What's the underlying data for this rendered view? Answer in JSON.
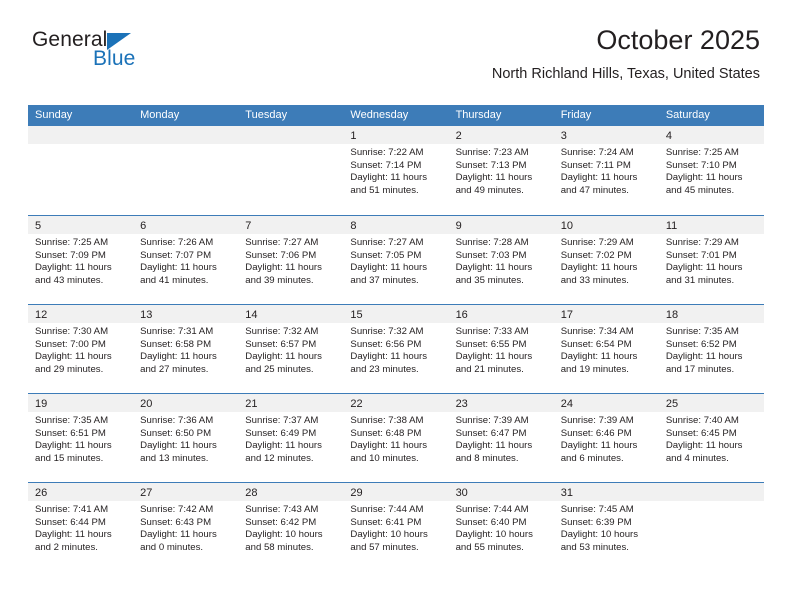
{
  "brand": {
    "name_part1": "General",
    "name_part2": "Blue",
    "triangle_icon": "blue-triangle-icon",
    "accent_color": "#1b72b8"
  },
  "header": {
    "title": "October 2025",
    "subtitle": "North Richland Hills, Texas, United States"
  },
  "theme": {
    "header_band": "#3d7cb8",
    "day_strip": "#f1f1f1",
    "text": "#231f20"
  },
  "weekdays": [
    "Sunday",
    "Monday",
    "Tuesday",
    "Wednesday",
    "Thursday",
    "Friday",
    "Saturday"
  ],
  "weeks": [
    [
      {
        "day": "",
        "sunrise": "",
        "sunset": "",
        "daylight1": "",
        "daylight2": ""
      },
      {
        "day": "",
        "sunrise": "",
        "sunset": "",
        "daylight1": "",
        "daylight2": ""
      },
      {
        "day": "",
        "sunrise": "",
        "sunset": "",
        "daylight1": "",
        "daylight2": ""
      },
      {
        "day": "1",
        "sunrise": "Sunrise: 7:22 AM",
        "sunset": "Sunset: 7:14 PM",
        "daylight1": "Daylight: 11 hours",
        "daylight2": "and 51 minutes."
      },
      {
        "day": "2",
        "sunrise": "Sunrise: 7:23 AM",
        "sunset": "Sunset: 7:13 PM",
        "daylight1": "Daylight: 11 hours",
        "daylight2": "and 49 minutes."
      },
      {
        "day": "3",
        "sunrise": "Sunrise: 7:24 AM",
        "sunset": "Sunset: 7:11 PM",
        "daylight1": "Daylight: 11 hours",
        "daylight2": "and 47 minutes."
      },
      {
        "day": "4",
        "sunrise": "Sunrise: 7:25 AM",
        "sunset": "Sunset: 7:10 PM",
        "daylight1": "Daylight: 11 hours",
        "daylight2": "and 45 minutes."
      }
    ],
    [
      {
        "day": "5",
        "sunrise": "Sunrise: 7:25 AM",
        "sunset": "Sunset: 7:09 PM",
        "daylight1": "Daylight: 11 hours",
        "daylight2": "and 43 minutes."
      },
      {
        "day": "6",
        "sunrise": "Sunrise: 7:26 AM",
        "sunset": "Sunset: 7:07 PM",
        "daylight1": "Daylight: 11 hours",
        "daylight2": "and 41 minutes."
      },
      {
        "day": "7",
        "sunrise": "Sunrise: 7:27 AM",
        "sunset": "Sunset: 7:06 PM",
        "daylight1": "Daylight: 11 hours",
        "daylight2": "and 39 minutes."
      },
      {
        "day": "8",
        "sunrise": "Sunrise: 7:27 AM",
        "sunset": "Sunset: 7:05 PM",
        "daylight1": "Daylight: 11 hours",
        "daylight2": "and 37 minutes."
      },
      {
        "day": "9",
        "sunrise": "Sunrise: 7:28 AM",
        "sunset": "Sunset: 7:03 PM",
        "daylight1": "Daylight: 11 hours",
        "daylight2": "and 35 minutes."
      },
      {
        "day": "10",
        "sunrise": "Sunrise: 7:29 AM",
        "sunset": "Sunset: 7:02 PM",
        "daylight1": "Daylight: 11 hours",
        "daylight2": "and 33 minutes."
      },
      {
        "day": "11",
        "sunrise": "Sunrise: 7:29 AM",
        "sunset": "Sunset: 7:01 PM",
        "daylight1": "Daylight: 11 hours",
        "daylight2": "and 31 minutes."
      }
    ],
    [
      {
        "day": "12",
        "sunrise": "Sunrise: 7:30 AM",
        "sunset": "Sunset: 7:00 PM",
        "daylight1": "Daylight: 11 hours",
        "daylight2": "and 29 minutes."
      },
      {
        "day": "13",
        "sunrise": "Sunrise: 7:31 AM",
        "sunset": "Sunset: 6:58 PM",
        "daylight1": "Daylight: 11 hours",
        "daylight2": "and 27 minutes."
      },
      {
        "day": "14",
        "sunrise": "Sunrise: 7:32 AM",
        "sunset": "Sunset: 6:57 PM",
        "daylight1": "Daylight: 11 hours",
        "daylight2": "and 25 minutes."
      },
      {
        "day": "15",
        "sunrise": "Sunrise: 7:32 AM",
        "sunset": "Sunset: 6:56 PM",
        "daylight1": "Daylight: 11 hours",
        "daylight2": "and 23 minutes."
      },
      {
        "day": "16",
        "sunrise": "Sunrise: 7:33 AM",
        "sunset": "Sunset: 6:55 PM",
        "daylight1": "Daylight: 11 hours",
        "daylight2": "and 21 minutes."
      },
      {
        "day": "17",
        "sunrise": "Sunrise: 7:34 AM",
        "sunset": "Sunset: 6:54 PM",
        "daylight1": "Daylight: 11 hours",
        "daylight2": "and 19 minutes."
      },
      {
        "day": "18",
        "sunrise": "Sunrise: 7:35 AM",
        "sunset": "Sunset: 6:52 PM",
        "daylight1": "Daylight: 11 hours",
        "daylight2": "and 17 minutes."
      }
    ],
    [
      {
        "day": "19",
        "sunrise": "Sunrise: 7:35 AM",
        "sunset": "Sunset: 6:51 PM",
        "daylight1": "Daylight: 11 hours",
        "daylight2": "and 15 minutes."
      },
      {
        "day": "20",
        "sunrise": "Sunrise: 7:36 AM",
        "sunset": "Sunset: 6:50 PM",
        "daylight1": "Daylight: 11 hours",
        "daylight2": "and 13 minutes."
      },
      {
        "day": "21",
        "sunrise": "Sunrise: 7:37 AM",
        "sunset": "Sunset: 6:49 PM",
        "daylight1": "Daylight: 11 hours",
        "daylight2": "and 12 minutes."
      },
      {
        "day": "22",
        "sunrise": "Sunrise: 7:38 AM",
        "sunset": "Sunset: 6:48 PM",
        "daylight1": "Daylight: 11 hours",
        "daylight2": "and 10 minutes."
      },
      {
        "day": "23",
        "sunrise": "Sunrise: 7:39 AM",
        "sunset": "Sunset: 6:47 PM",
        "daylight1": "Daylight: 11 hours",
        "daylight2": "and 8 minutes."
      },
      {
        "day": "24",
        "sunrise": "Sunrise: 7:39 AM",
        "sunset": "Sunset: 6:46 PM",
        "daylight1": "Daylight: 11 hours",
        "daylight2": "and 6 minutes."
      },
      {
        "day": "25",
        "sunrise": "Sunrise: 7:40 AM",
        "sunset": "Sunset: 6:45 PM",
        "daylight1": "Daylight: 11 hours",
        "daylight2": "and 4 minutes."
      }
    ],
    [
      {
        "day": "26",
        "sunrise": "Sunrise: 7:41 AM",
        "sunset": "Sunset: 6:44 PM",
        "daylight1": "Daylight: 11 hours",
        "daylight2": "and 2 minutes."
      },
      {
        "day": "27",
        "sunrise": "Sunrise: 7:42 AM",
        "sunset": "Sunset: 6:43 PM",
        "daylight1": "Daylight: 11 hours",
        "daylight2": "and 0 minutes."
      },
      {
        "day": "28",
        "sunrise": "Sunrise: 7:43 AM",
        "sunset": "Sunset: 6:42 PM",
        "daylight1": "Daylight: 10 hours",
        "daylight2": "and 58 minutes."
      },
      {
        "day": "29",
        "sunrise": "Sunrise: 7:44 AM",
        "sunset": "Sunset: 6:41 PM",
        "daylight1": "Daylight: 10 hours",
        "daylight2": "and 57 minutes."
      },
      {
        "day": "30",
        "sunrise": "Sunrise: 7:44 AM",
        "sunset": "Sunset: 6:40 PM",
        "daylight1": "Daylight: 10 hours",
        "daylight2": "and 55 minutes."
      },
      {
        "day": "31",
        "sunrise": "Sunrise: 7:45 AM",
        "sunset": "Sunset: 6:39 PM",
        "daylight1": "Daylight: 10 hours",
        "daylight2": "and 53 minutes."
      },
      {
        "day": "",
        "sunrise": "",
        "sunset": "",
        "daylight1": "",
        "daylight2": ""
      }
    ]
  ]
}
